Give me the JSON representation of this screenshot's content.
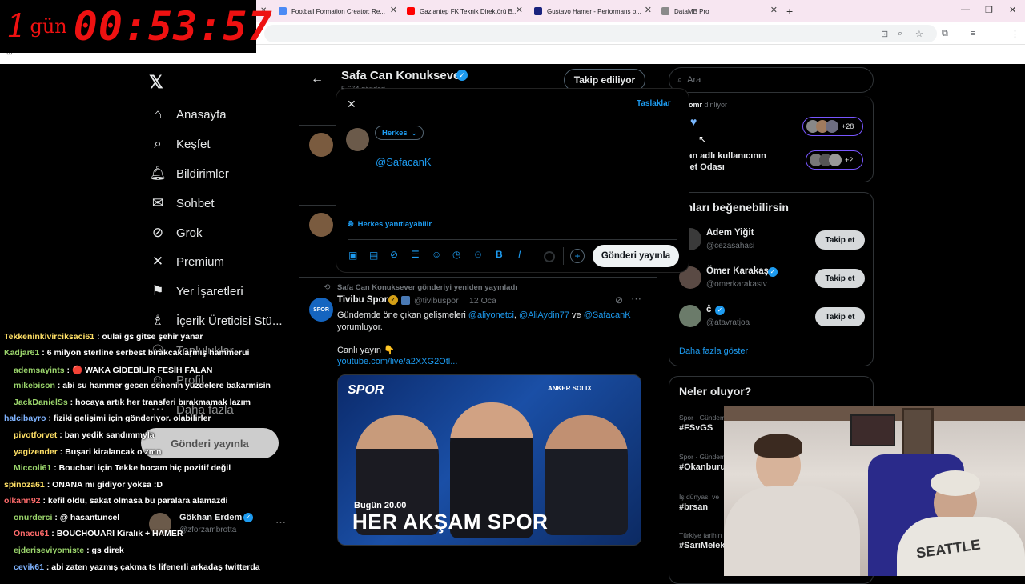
{
  "timer": {
    "day_num": "1",
    "day_text": "gün",
    "clock": "00:53:57"
  },
  "tabs": [
    {
      "title": "Football Formation Creator: Re...",
      "color": "#4c8bf5"
    },
    {
      "title": "Gaziantep FK Teknik Direktörü B...",
      "color": "#ff0000"
    },
    {
      "title": "Gustavo Hamer - Performans b...",
      "color": "#1a237e"
    },
    {
      "title": "DataMB Pro",
      "color": "#8a8a8a"
    }
  ],
  "nav": [
    {
      "label": "Anasayfa",
      "icon": "home-icon"
    },
    {
      "label": "Keşfet",
      "icon": "search-icon"
    },
    {
      "label": "Bildirimler",
      "icon": "bell-icon"
    },
    {
      "label": "Sohbet",
      "icon": "mail-icon"
    },
    {
      "label": "Grok",
      "icon": "grok-icon"
    },
    {
      "label": "Premium",
      "icon": "x-icon"
    },
    {
      "label": "Yer İşaretleri",
      "icon": "bookmark-icon"
    },
    {
      "label": "İçerik Üreticisi Stü...",
      "icon": "creator-icon"
    },
    {
      "label": "Topluluklar",
      "icon": "people-icon"
    },
    {
      "label": "Profil",
      "icon": "profile-icon"
    },
    {
      "label": "Daha fazla",
      "icon": "more-icon"
    }
  ],
  "sidebar_post_button": "Gönderi yayınla",
  "account": {
    "name": "Gökhan Erdem",
    "handle": "@zforzambrotta"
  },
  "profile_header": {
    "name": "Safa Can Konuksever",
    "sub": "5.674 gönderi",
    "follow_label": "Takip ediliyor"
  },
  "compose": {
    "drafts": "Taslaklar",
    "audience": "Herkes",
    "text": "@SafacanK",
    "reply_setting": "Herkes yanıtlayabilir",
    "post_button": "Gönderi yayınla"
  },
  "repost_note": "Safa Can Konuksever gönderiyi yeniden yayınladı",
  "tweet": {
    "author": "Tivibu Spor",
    "handle": "@tivibuspor",
    "date": "12 Oca",
    "text_pre": "Gündemde öne çıkan gelişmeleri",
    "mention1": "@aliyonetci",
    "mention2": "@AliAydin77",
    "and": "ve",
    "mention3": "@SafacanK",
    "text_post": "yorumluyor.",
    "live": "Canlı yayın",
    "link": "youtube.com/live/a2XXG2Otl...",
    "image_brand": "SPOR",
    "image_sponsor": "ANKER SOLIX",
    "image_time": "Bugün 20.00",
    "image_title": "HER AKŞAM SPOR"
  },
  "search_placeholder": "Ara",
  "spaces": {
    "listening": "omr",
    "listening_suffix": "dinliyor",
    "count1": "+28",
    "room_title_line1": "rkan adlı kullanıcının",
    "room_title_line2": "hbet Odası",
    "count2": "+2"
  },
  "who_to_follow": {
    "title": "unları beğenebilirsin",
    "users": [
      {
        "name": "Adem Yiğit",
        "handle": "@cezasahasi",
        "verified": false
      },
      {
        "name": "Ömer Karakaş",
        "handle": "@omerkarakastv",
        "verified": true
      },
      {
        "name": "ĉ",
        "handle": "@atavratjoa",
        "verified": true
      }
    ],
    "follow_label": "Takip et",
    "more": "Daha fazla göster"
  },
  "trends": {
    "title": "Neler oluyor?",
    "items": [
      {
        "context": "Spor · Gündem",
        "name": "#FSvGS"
      },
      {
        "context": "Spor · Gündem",
        "name": "#Okanburu"
      },
      {
        "context": "İş dünyası ve",
        "name": "#brsan"
      },
      {
        "context": "Türkiye tarihin",
        "name": "#SarıMelek"
      }
    ]
  },
  "chat": [
    {
      "user": "Tekkeninkivirciksaci61",
      "text": ": oulai gs gitse şehir yanar",
      "color": "#ffe066"
    },
    {
      "user": "Kadjar61",
      "text": ": 6 milyon sterline serbest bırakcaklarmış hammerui",
      "color": "#9ad46b"
    },
    {
      "user": "ademsayints",
      "text": ": 🔴 WAKA GİDEBİLİR FESİH FALAN",
      "color": "#9ad46b"
    },
    {
      "user": "mikebison",
      "text": ": abi su hammer gecen senenin yuzdelere bakarmisin",
      "color": "#9ad46b"
    },
    {
      "user": "JackDanielSs",
      "text": ": hocaya artık her transferi bırakmamak lazım",
      "color": "#9ad46b"
    },
    {
      "user": "halcibayro",
      "text": ": fiziki gelişimi için gönderiyor. olabilirler",
      "color": "#7fb3ff"
    },
    {
      "user": "pivotforvet",
      "text": ": ban yedik sandımmyla",
      "color": "#ffe066"
    },
    {
      "user": "yagizender",
      "text": ": Buşari kiralancak o zmn",
      "color": "#ffe066"
    },
    {
      "user": "Miccoli61",
      "text": ": Bouchari için Tekke hocam hiç pozitif değil",
      "color": "#9ad46b"
    },
    {
      "user": "spinoza61",
      "text": ": ONANA mı gidiyor yoksa :D",
      "color": "#ffe066"
    },
    {
      "user": "olkann92",
      "text": ": kefil oldu, sakat olmasa bu paralara alamazdi",
      "color": "#ff6b6b"
    },
    {
      "user": "onurderci",
      "text": ": @ hasantuncel",
      "color": "#9ad46b"
    },
    {
      "user": "Onacu61",
      "text": ": BOUCHOUARI Kiralık + HAMER",
      "color": "#ff6b6b"
    },
    {
      "user": "ejderiseviyomiste",
      "text": ": gs direk",
      "color": "#9ad46b"
    },
    {
      "user": "cevik61",
      "text": ": abi zaten yazmış çakma ts lifenerli arkadaş twitterda",
      "color": "#7fb3ff"
    }
  ]
}
